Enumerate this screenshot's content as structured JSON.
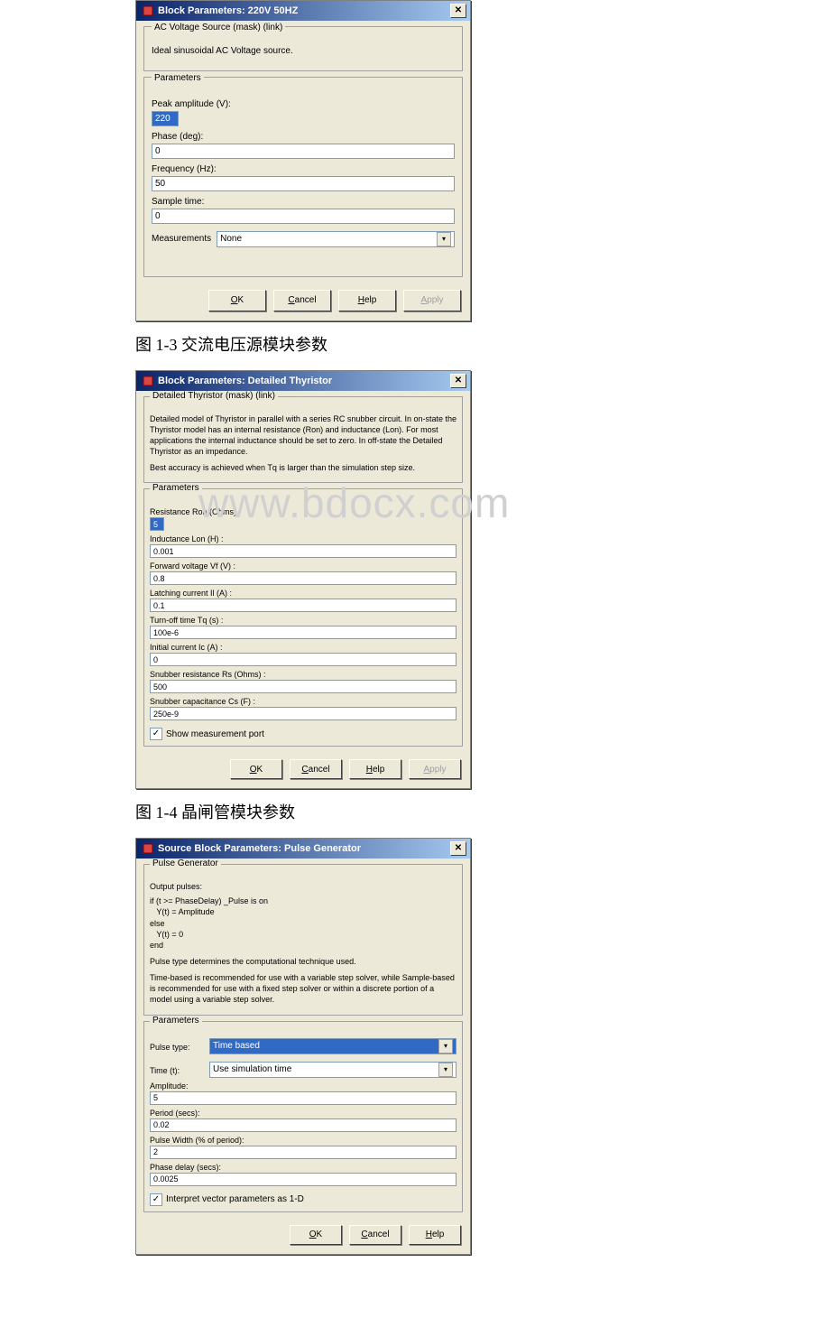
{
  "dialog1": {
    "title": "Block Parameters: 220V 50HZ",
    "section1_legend": "AC Voltage Source (mask) (link)",
    "section1_desc": "Ideal sinusoidal AC Voltage source.",
    "params_legend": "Parameters",
    "peak_label": "Peak amplitude (V):",
    "peak_value": "220",
    "phase_label": "Phase (deg):",
    "phase_value": "0",
    "freq_label": "Frequency (Hz):",
    "freq_value": "50",
    "sample_label": "Sample time:",
    "sample_value": "0",
    "meas_label": "Measurements",
    "meas_value": "None",
    "ok": "OK",
    "cancel": "Cancel",
    "help": "Help",
    "apply": "Apply"
  },
  "caption1": "图 1-3 交流电压源模块参数",
  "dialog2": {
    "title": "Block Parameters: Detailed Thyristor",
    "section1_legend": "Detailed Thyristor (mask) (link)",
    "section1_desc": "Detailed model of Thyristor in parallel with a series RC snubber circuit. In on-state the Thyristor model has an internal resistance (Ron) and inductance (Lon).  For most applications the internal inductance should be set to zero. In off-state the Detailed Thyristor  as an impedance.",
    "section1_desc2": "Best accuracy is achieved when Tq is larger than the simulation step size.",
    "params_legend": "Parameters",
    "ron_label": "Resistance Ron (Ohms) :",
    "ron_value": "5",
    "lon_label": "Inductance Lon (H) :",
    "lon_value": "0.001",
    "vf_label": "Forward voltage Vf (V) :",
    "vf_value": "0.8",
    "il_label": "Latching current Il (A) :",
    "il_value": "0.1",
    "tq_label": "Turn-off time Tq (s) :",
    "tq_value": "100e-6",
    "ic_label": "Initial current Ic (A) :",
    "ic_value": "0",
    "rs_label": "Snubber resistance Rs (Ohms) :",
    "rs_value": "500",
    "cs_label": "Snubber capacitance Cs (F) :",
    "cs_value": "250e-9",
    "show_label": "Show measurement port",
    "ok": "OK",
    "cancel": "Cancel",
    "help": "Help",
    "apply": "Apply"
  },
  "caption2": "图 1-4 晶闸管模块参数",
  "dialog3": {
    "title": "Source Block Parameters: Pulse Generator",
    "section1_legend": "Pulse Generator",
    "section1_line1": "Output pulses:",
    "section1_code": "if (t >= PhaseDelay) _Pulse is on\n   Y(t) = Amplitude\nelse\n   Y(t) = 0\nend",
    "section1_line2": "Pulse type determines the computational technique used.",
    "section1_line3": "Time-based is recommended for use with a variable step solver, while Sample-based is recommended for use with a fixed step solver or within a discrete portion of a model using a variable step solver.",
    "params_legend": "Parameters",
    "ptype_label": "Pulse type:",
    "ptype_value": "Time based",
    "time_label": "Time (t):",
    "time_value": "Use simulation time",
    "amp_label": "Amplitude:",
    "amp_value": "5",
    "period_label": "Period (secs):",
    "period_value": "0.02",
    "pw_label": "Pulse Width (% of period):",
    "pw_value": "2",
    "pd_label": "Phase delay (secs):",
    "pd_value": "0.0025",
    "interp_label": "Interpret vector parameters as 1-D",
    "ok": "OK",
    "cancel": "Cancel",
    "help": "Help"
  },
  "watermark": "www.bdocx.com"
}
